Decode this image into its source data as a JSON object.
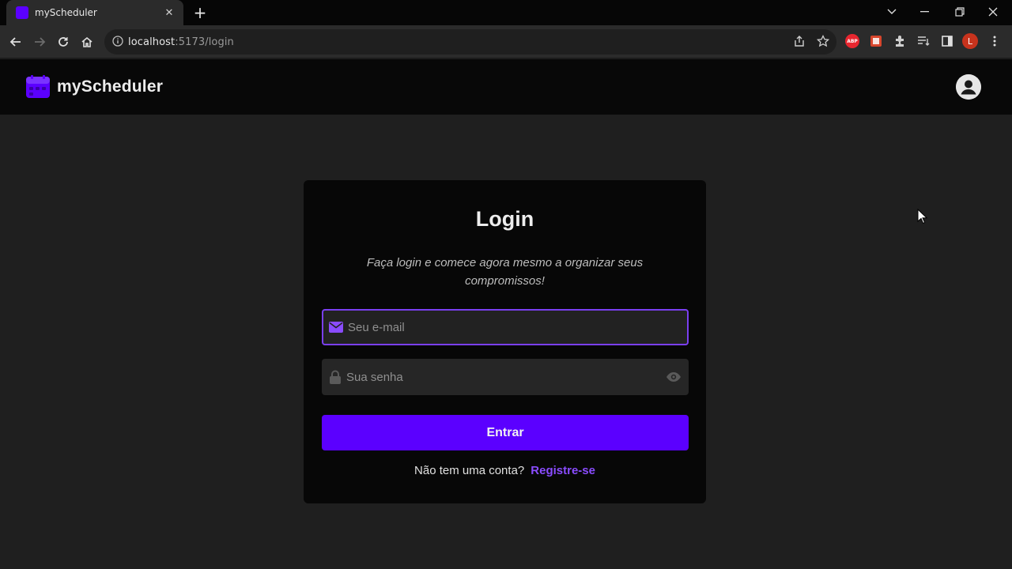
{
  "browser": {
    "tab": {
      "title": "myScheduler",
      "close": "✕"
    },
    "new_tab": "+",
    "url": {
      "host": "localhost",
      "path": ":5173/login"
    },
    "profile_initial": "L",
    "abp_label": "ABP"
  },
  "app": {
    "brand": "myScheduler",
    "accent_color": "#5b00ff"
  },
  "login": {
    "title": "Login",
    "subtitle": "Faça login e comece agora mesmo a organizar seus compromissos!",
    "email_placeholder": "Seu e-mail",
    "password_placeholder": "Sua senha",
    "submit_label": "Entrar",
    "no_account": "Não tem uma conta?",
    "register_link": "Registre-se"
  }
}
